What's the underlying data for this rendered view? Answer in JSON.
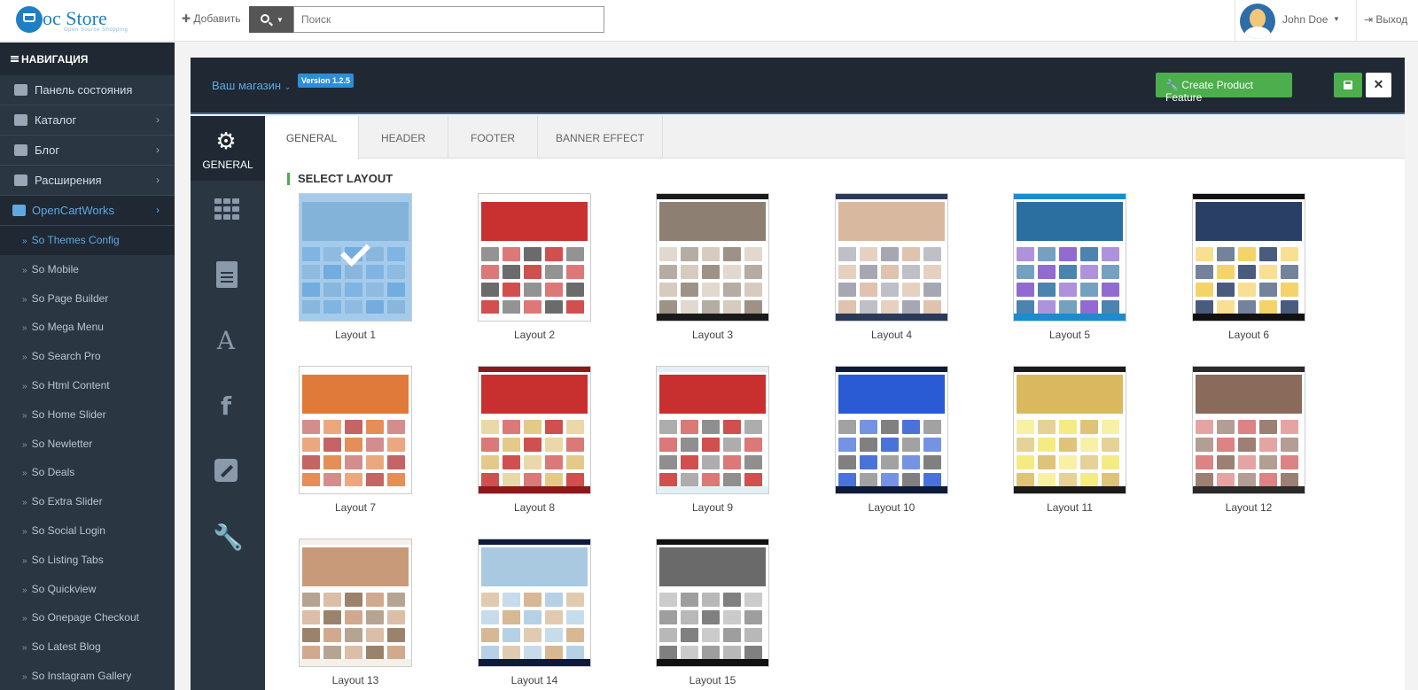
{
  "header": {
    "logo_text": "oc Store",
    "logo_subtitle": "Open Source Shopping",
    "add_label": "Добавить",
    "search_placeholder": "Поиск",
    "user_name": "John Doe",
    "logout_label": "Выход"
  },
  "sidebar": {
    "title": "НАВИГАЦИЯ",
    "items": [
      {
        "label": "Панель состояния",
        "icon": "dashboard-icon",
        "has_children": false
      },
      {
        "label": "Каталог",
        "icon": "tags-icon",
        "has_children": true
      },
      {
        "label": "Блог",
        "icon": "book-icon",
        "has_children": true
      },
      {
        "label": "Расширения",
        "icon": "puzzle-icon",
        "has_children": true
      },
      {
        "label": "OpenCartWorks",
        "icon": "cubes-icon",
        "has_children": true
      }
    ],
    "sub_items": [
      "So Themes Config",
      "So Mobile",
      "So Page Builder",
      "So Mega Menu",
      "So Search Pro",
      "So Html Content",
      "So Home Slider",
      "So Newletter",
      "So Deals",
      "So Extra Slider",
      "So Social Login",
      "So Listing Tabs",
      "So Quickview",
      "So Onepage Checkout",
      "So Latest Blog",
      "So Instagram Gallery"
    ]
  },
  "panel": {
    "store_label": "Ваш магазин",
    "version": "Version 1.2.5",
    "create_button": "Create Product Feature",
    "vertical_tabs": [
      {
        "label": "GENERAL",
        "icon": "gear-icon"
      },
      {
        "label": "",
        "icon": "grid-icon"
      },
      {
        "label": "",
        "icon": "file-icon"
      },
      {
        "label": "",
        "icon": "font-icon"
      },
      {
        "label": "",
        "icon": "facebook-icon"
      },
      {
        "label": "",
        "icon": "edit-icon"
      },
      {
        "label": "",
        "icon": "wrench-icon"
      }
    ],
    "tabs": [
      "GENERAL",
      "HEADER",
      "FOOTER",
      "BANNER EFFECT"
    ],
    "section_title": "SELECT LAYOUT",
    "selected_layout": "Layout 1",
    "layouts": [
      {
        "label": "Layout 1",
        "colors": [
          "#ffffff",
          "#b9c9d6",
          "#6ea4d4"
        ]
      },
      {
        "label": "Layout 2",
        "colors": [
          "#ffffff",
          "#c93030",
          "#3a3a3a"
        ]
      },
      {
        "label": "Layout 3",
        "colors": [
          "#1a1a1a",
          "#8d7f72",
          "#c9b9a9"
        ]
      },
      {
        "label": "Layout 4",
        "colors": [
          "#2a3a5a",
          "#d9b8a0",
          "#8a8a9a"
        ]
      },
      {
        "label": "Layout 5",
        "colors": [
          "#1a8ccf",
          "#2b6fa0",
          "#6c3ac0"
        ]
      },
      {
        "label": "Layout 6",
        "colors": [
          "#111111",
          "#2a3f66",
          "#f2c43a"
        ]
      },
      {
        "label": "Layout 7",
        "colors": [
          "#ffffff",
          "#e07a3a",
          "#b03030"
        ]
      },
      {
        "label": "Layout 8",
        "colors": [
          "#8a1a1a",
          "#c83030",
          "#d9b860"
        ]
      },
      {
        "label": "Layout 9",
        "colors": [
          "#e3f1f7",
          "#c83030",
          "#6a6a6a"
        ]
      },
      {
        "label": "Layout 10",
        "colors": [
          "#0e1a3a",
          "#2a5ad4",
          "#555555"
        ]
      },
      {
        "label": "Layout 11",
        "colors": [
          "#1a1a1a",
          "#d9b860",
          "#f2e45a"
        ]
      },
      {
        "label": "Layout 12",
        "colors": [
          "#2a2a2a",
          "#8a6a5a",
          "#d05a5a"
        ]
      },
      {
        "label": "Layout 13",
        "colors": [
          "#f5f0ea",
          "#c99a7a",
          "#7a5a3a"
        ]
      },
      {
        "label": "Layout 14",
        "colors": [
          "#0e1a3a",
          "#a9c9e0",
          "#c9a070"
        ]
      },
      {
        "label": "Layout 15",
        "colors": [
          "#111111",
          "#6a6a6a",
          "#a0a0a0"
        ]
      }
    ]
  }
}
